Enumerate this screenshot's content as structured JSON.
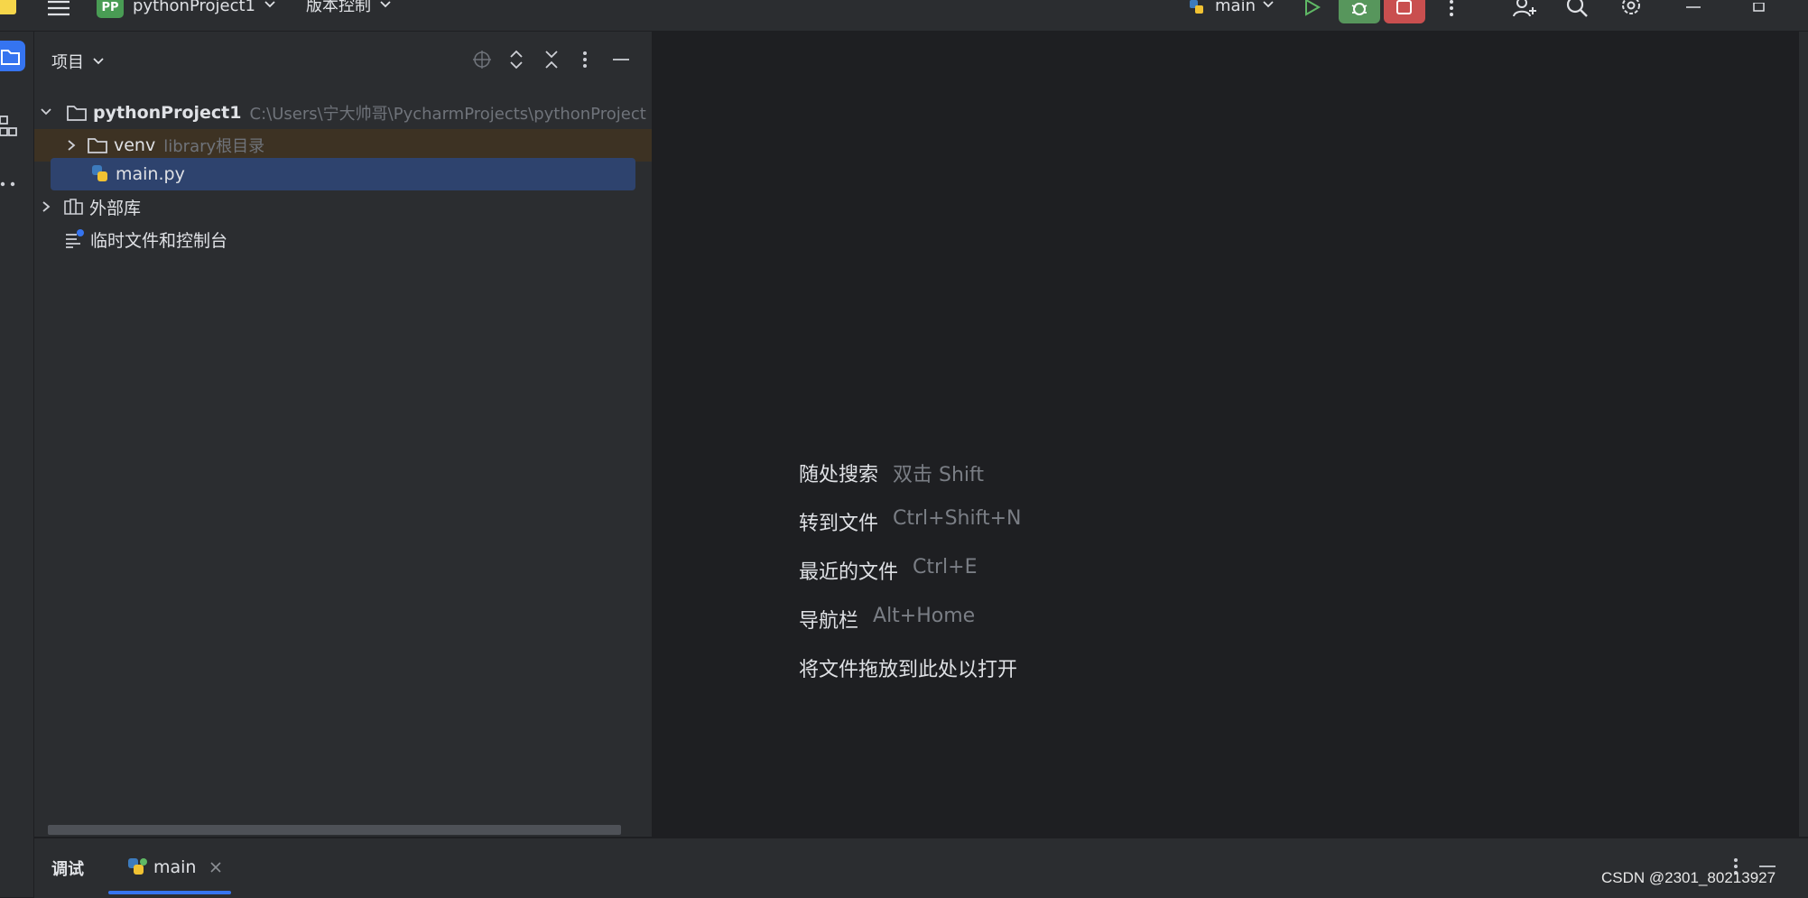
{
  "titlebar": {
    "project_badge": "PP",
    "project_name": "pythonProject1",
    "vcs_label": "版本控制",
    "run_config": "main"
  },
  "project_panel": {
    "title": "项目",
    "tree": {
      "root_name": "pythonProject1",
      "root_path": "C:\\Users\\宁大帅哥\\PycharmProjects\\pythonProject",
      "venv_name": "venv",
      "venv_note": "library根目录",
      "main_file": "main.py",
      "external_libs": "外部库",
      "scratches": "临时文件和控制台"
    }
  },
  "editor_hints": [
    {
      "label": "随处搜索",
      "key": "双击 Shift"
    },
    {
      "label": "转到文件",
      "key": "Ctrl+Shift+N"
    },
    {
      "label": "最近的文件",
      "key": "Ctrl+E"
    },
    {
      "label": "导航栏",
      "key": "Alt+Home"
    },
    {
      "label": "将文件拖放到此处以打开",
      "key": ""
    }
  ],
  "bottom": {
    "debug_label": "调试",
    "tab_label": "main"
  },
  "watermark": "CSDN @2301_80213927",
  "colors": {
    "accent": "#3574f0",
    "run_green": "#5fb865",
    "debug_green": "#57965c",
    "stop_red": "#c94f4f",
    "selection": "#2e436e",
    "library_bg": "#3d3223"
  },
  "icons": [
    "hamburger-icon",
    "run-icon",
    "debug-icon",
    "stop-icon",
    "more-icon",
    "add-user-icon",
    "search-icon",
    "settings-icon",
    "minimize-icon",
    "maximize-icon",
    "folder-icon",
    "structure-icon",
    "locate-icon",
    "expand-all-icon",
    "collapse-all-icon",
    "python-file-icon",
    "library-icon",
    "scratch-icon",
    "close-icon"
  ]
}
